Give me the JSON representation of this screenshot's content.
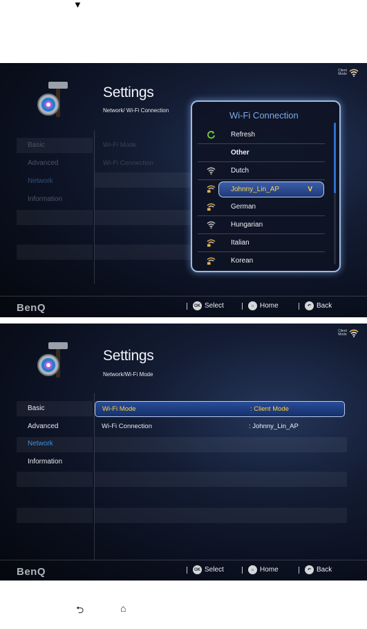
{
  "top_arrow": "▼",
  "screen1": {
    "title": "Settings",
    "breadcrumb": "Network/ Wi-Fi Connection",
    "client_mode": "Client Mode",
    "nav": [
      "Basic",
      "Advanced",
      "Network",
      "Information"
    ],
    "settings_rows": [
      "Wi-Fi Mode",
      "Wi-Fi  Connection"
    ],
    "popup": {
      "title": "Wi-Fi Connection",
      "items": [
        {
          "label": "Refresh",
          "icon": "refresh-icon"
        },
        {
          "label": "Other",
          "icon": ""
        },
        {
          "label": "Dutch",
          "icon": "wifi-icon"
        },
        {
          "label": "Johnny_Lin_AP",
          "icon": "wifi-lock-icon",
          "selected_mark": "V"
        },
        {
          "label": "German",
          "icon": "wifi-lock-icon"
        },
        {
          "label": "Hungarian",
          "icon": "wifi-icon"
        },
        {
          "label": "Italian",
          "icon": "wifi-lock-icon"
        },
        {
          "label": "Korean",
          "icon": "wifi-lock-icon"
        }
      ]
    },
    "bottom": {
      "brand": "BenQ",
      "select": "Select",
      "home": "Home",
      "back": "Back",
      "ok_badge": "OK"
    }
  },
  "screen2": {
    "title": "Settings",
    "breadcrumb": "Network/Wi-Fi Mode",
    "client_mode": "Client Mode",
    "nav": [
      "Basic",
      "Advanced",
      "Network",
      "Information"
    ],
    "wifi_mode_label": "Wi-Fi Mode",
    "wifi_mode_value": ":  Client Mode",
    "wifi_conn_label": "Wi-Fi Connection",
    "wifi_conn_value": ":  Johnny_Lin_AP",
    "bottom": {
      "brand": "BenQ",
      "select": "Select",
      "home": "Home",
      "back": "Back",
      "ok_badge": "OK"
    }
  },
  "android_keys": {
    "back": "⮌",
    "home": "⌂"
  }
}
